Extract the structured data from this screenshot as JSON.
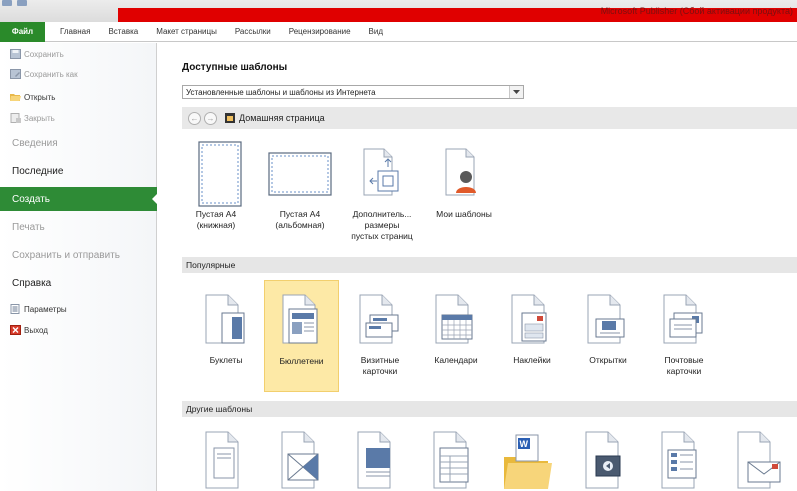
{
  "window": {
    "title": "Microsoft Publisher (Сбой активации продукта)"
  },
  "ribbon": {
    "file_tab": "Файл",
    "tabs": [
      "Главная",
      "Вставка",
      "Макет страницы",
      "Рассылки",
      "Рецензирование",
      "Вид"
    ]
  },
  "nav": {
    "save": "Сохранить",
    "save_as": "Сохранить как",
    "open": "Открыть",
    "close": "Закрыть",
    "info": "Сведения",
    "recent": "Последние",
    "new": "Создать",
    "print": "Печать",
    "save_send": "Сохранить и отправить",
    "help": "Справка",
    "options": "Параметры",
    "exit": "Выход"
  },
  "main": {
    "title": "Доступные шаблоны",
    "source_select": "Установленные шаблоны и шаблоны из Интернета",
    "home_label": "Домашняя страница",
    "blank_tiles": [
      {
        "label": "Пустая A4\n(книжная)"
      },
      {
        "label": "Пустая A4\n(альбомная)"
      },
      {
        "label": "Дополнитель...\nразмеры\nпустых страниц"
      },
      {
        "label": "Мои шаблоны"
      }
    ],
    "popular_header": "Популярные",
    "popular_tiles": [
      {
        "label": "Буклеты"
      },
      {
        "label": "Бюллетени"
      },
      {
        "label": "Визитные\nкарточки"
      },
      {
        "label": "Календари"
      },
      {
        "label": "Наклейки"
      },
      {
        "label": "Открытки"
      },
      {
        "label": "Почтовые\nкарточки"
      }
    ],
    "other_header": "Другие шаблоны"
  },
  "colors": {
    "file_tab": "#2a8a2a",
    "nav_active": "#2e8b36",
    "selected_tile": "#fde9a6",
    "title_band": "#e00000"
  }
}
